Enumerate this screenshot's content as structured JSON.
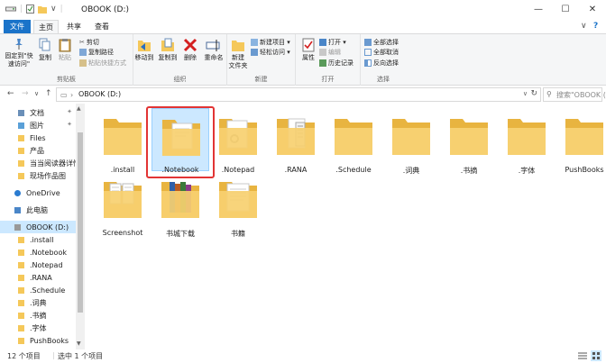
{
  "window": {
    "title": "OBOOK (D:)",
    "qat_dropdown": "∨",
    "minimize": "—",
    "maximize": "☐",
    "close": "✕"
  },
  "tabs": [
    {
      "label": "文件"
    },
    {
      "label": "主页"
    },
    {
      "label": "共享"
    },
    {
      "label": "查看"
    }
  ],
  "ribbon_right": {
    "collapse": "∨",
    "help": "?"
  },
  "ribbon": {
    "clipboard": {
      "label": "剪贴板",
      "pin": "固定到\"快速访问\"",
      "copy": "复制",
      "paste": "粘贴",
      "cut": "剪切",
      "copy_path": "复制路径",
      "paste_shortcut": "粘贴快捷方式"
    },
    "organize": {
      "label": "组织",
      "move_to": "移动到",
      "copy_to": "复制到",
      "delete": "删除",
      "rename": "重命名"
    },
    "new": {
      "label": "新建",
      "new_folder": "新建\n文件夹",
      "new_item": "新建项目 ▾",
      "easy_access": "轻松访问 ▾"
    },
    "open": {
      "label": "打开",
      "properties": "属性",
      "open": "打开 ▾",
      "edit": "编辑",
      "history": "历史记录"
    },
    "select": {
      "label": "选择",
      "select_all": "全部选择",
      "select_none": "全部取消",
      "invert": "反向选择"
    }
  },
  "address": {
    "back": "←",
    "forward": "→",
    "recent": "∨",
    "up": "↑",
    "path_icon": "▭",
    "separator": "›",
    "path": "OBOOK (D:)",
    "dropdown": "∨",
    "refresh": "↻",
    "search_placeholder": "搜索\"OBOOK (D:)\""
  },
  "nav_pane": {
    "items": [
      {
        "label": "文档",
        "pinned": true
      },
      {
        "label": "图片",
        "pinned": true
      },
      {
        "label": "Files"
      },
      {
        "label": "产品"
      },
      {
        "label": "当当阅读器详情页"
      },
      {
        "label": "现场作品图"
      },
      {
        "label": "OneDrive"
      },
      {
        "label": "此电脑"
      },
      {
        "label": "OBOOK (D:)"
      },
      {
        "label": ".install"
      },
      {
        "label": ".Notebook"
      },
      {
        "label": ".Notepad"
      },
      {
        "label": ".RANA"
      },
      {
        "label": ".Schedule"
      },
      {
        "label": ".词典"
      },
      {
        "label": ".书摘"
      },
      {
        "label": ".字体"
      },
      {
        "label": "PushBooks"
      }
    ],
    "pin_glyph": "✦",
    "scroll_up": "▲",
    "scroll_down": "▼"
  },
  "files": [
    {
      "label": ".install",
      "kind": "folder"
    },
    {
      "label": ".Notebook",
      "kind": "doc-folder",
      "selected": true
    },
    {
      "label": ".Notepad",
      "kind": "gear-folder"
    },
    {
      "label": ".RANA",
      "kind": "book-folder"
    },
    {
      "label": ".Schedule",
      "kind": "folder"
    },
    {
      "label": ".词典",
      "kind": "folder"
    },
    {
      "label": ".书摘",
      "kind": "folder"
    },
    {
      "label": ".字体",
      "kind": "folder"
    },
    {
      "label": "PushBooks",
      "kind": "folder"
    },
    {
      "label": "Screenshot",
      "kind": "pages-folder"
    },
    {
      "label": "书城下载",
      "kind": "books-folder"
    },
    {
      "label": "书籍",
      "kind": "paper-folder"
    }
  ],
  "status": {
    "count": "12 个项目",
    "selected": "选中 1 个项目"
  },
  "colors": {
    "accent": "#1a73c9",
    "selection": "#cce8ff",
    "folder": "#f5c85a",
    "highlight_box": "#e23434"
  }
}
